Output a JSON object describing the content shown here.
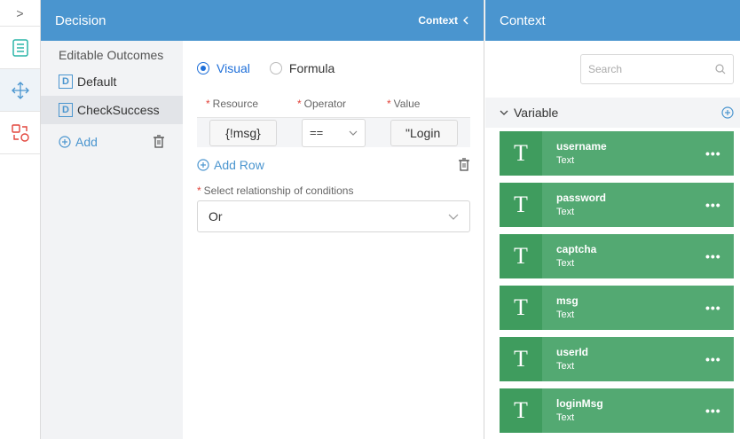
{
  "rail": {
    "toggle_glyph": ">",
    "items": [
      {
        "icon": "list-doc-icon",
        "color": "#2bb5a8"
      },
      {
        "icon": "move-arrows-icon",
        "color": "#4a95cf"
      },
      {
        "icon": "flow-switch-icon",
        "color": "#e2453c"
      }
    ]
  },
  "decision": {
    "title": "Decision",
    "context_link": "Context",
    "outcomes_header": "Editable Outcomes",
    "outcomes": [
      {
        "badge": "D",
        "label": "Default"
      },
      {
        "badge": "D",
        "label": "CheckSuccess"
      }
    ],
    "add_label": "Add",
    "mode": {
      "visual": "Visual",
      "formula": "Formula"
    },
    "columns": {
      "resource": "Resource",
      "operator": "Operator",
      "value": "Value"
    },
    "condition": {
      "resource": "{!msg}",
      "operator": "==",
      "value": "\"Login"
    },
    "add_row_label": "Add Row",
    "relationship_label": "Select relationship of conditions",
    "relationship_value": "Or"
  },
  "context": {
    "title": "Context",
    "search_placeholder": "Search",
    "section_label": "Variable",
    "variables": [
      {
        "icon": "T",
        "name": "username",
        "type": "Text"
      },
      {
        "icon": "T",
        "name": "password",
        "type": "Text"
      },
      {
        "icon": "T",
        "name": "captcha",
        "type": "Text"
      },
      {
        "icon": "T",
        "name": "msg",
        "type": "Text"
      },
      {
        "icon": "T",
        "name": "userId",
        "type": "Text"
      },
      {
        "icon": "T",
        "name": "loginMsg",
        "type": "Text"
      }
    ],
    "more_glyph": "•••"
  },
  "colors": {
    "header": "#4a95cf",
    "accent": "#1e6fd9",
    "variable_card": "#53a972",
    "variable_icon": "#3f9c5e",
    "required": "#e2453c"
  }
}
